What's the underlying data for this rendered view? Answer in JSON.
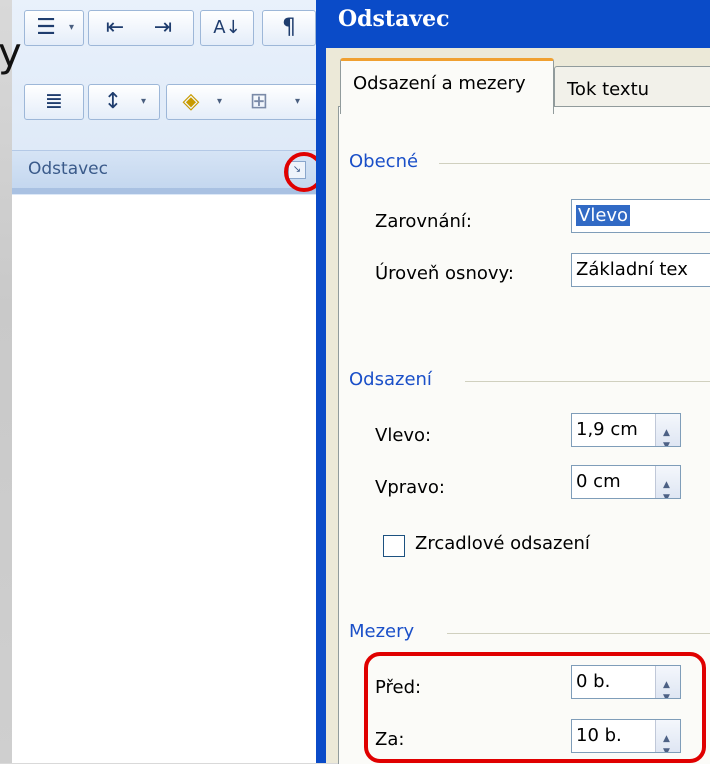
{
  "ribbon": {
    "group_label": "Odstavec",
    "launcher_icon": "dialog-launcher-icon",
    "buttons_row1": [
      "multilevel-list-icon",
      "decrease-indent-icon",
      "increase-indent-icon",
      "sort-icon",
      "pilcrow-icon"
    ],
    "buttons_row2": [
      "justify-icon",
      "line-spacing-icon",
      "shading-icon",
      "borders-icon"
    ]
  },
  "dialog": {
    "title": "Odstavec",
    "tabs": [
      "Odsazení a mezery",
      "Tok textu"
    ],
    "general": {
      "title": "Obecné",
      "alignment_label": "Zarovnání:",
      "alignment_value": "Vlevo",
      "outline_label": "Úroveň osnovy:",
      "outline_value": "Základní tex"
    },
    "indent": {
      "title": "Odsazení",
      "left_label": "Vlevo:",
      "left_value": "1,9 cm",
      "right_label": "Vpravo:",
      "right_value": "0 cm",
      "mirror_label": "Zrcadlové odsazení"
    },
    "spacing": {
      "title": "Mezery",
      "before_label": "Před:",
      "before_value": "0 b.",
      "after_label": "Za:",
      "after_value": "10 b."
    }
  },
  "colors": {
    "highlight": "#e00000",
    "title_bar": "#0a4bc8",
    "section_title": "#1a4fc8"
  }
}
